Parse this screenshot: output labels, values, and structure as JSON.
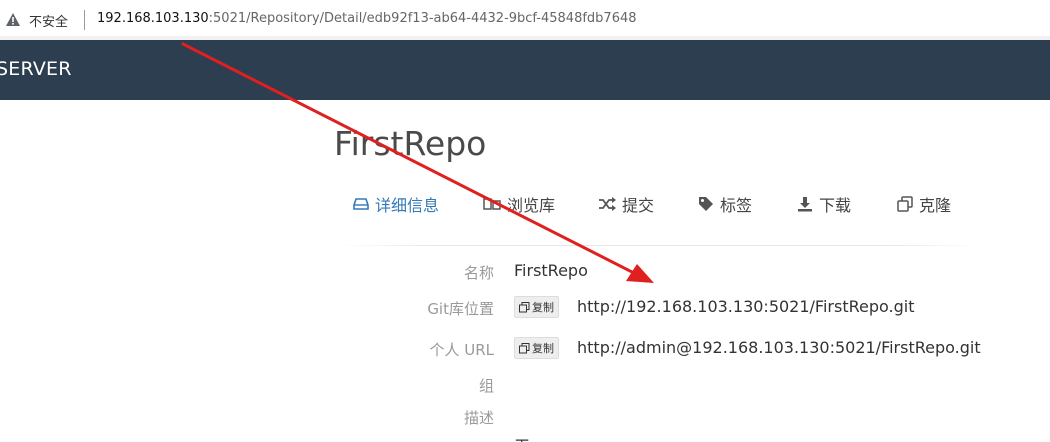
{
  "browser": {
    "security_label": "不安全",
    "url_host": "192.168.103.130",
    "url_rest": ":5021/Repository/Detail/edb92f13-ab64-4432-9bcf-45848fdb7648"
  },
  "navbar": {
    "brand": "SERVER"
  },
  "repo": {
    "title": "FirstRepo"
  },
  "tabs": [
    {
      "label": "详细信息",
      "icon": "drive-icon",
      "active": true
    },
    {
      "label": "浏览库",
      "icon": "browse-icon",
      "active": false
    },
    {
      "label": "提交",
      "icon": "shuffle-icon",
      "active": false
    },
    {
      "label": "标签",
      "icon": "tag-icon",
      "active": false
    },
    {
      "label": "下载",
      "icon": "download-icon",
      "active": false
    },
    {
      "label": "克隆",
      "icon": "clone-icon",
      "active": false
    }
  ],
  "details": {
    "name_label": "名称",
    "name_value": "FirstRepo",
    "git_label": "Git库位置",
    "git_url": "http://192.168.103.130:5021/FirstRepo.git",
    "personal_label": "个人 URL",
    "personal_url": "http://admin@192.168.103.130:5021/FirstRepo.git",
    "group_label": "组",
    "desc_label": "描述",
    "copy_label": "复制",
    "partial_value": "无"
  },
  "colors": {
    "navbar_bg": "#2d3e50",
    "active_tab": "#337ab7",
    "annotation_arrow": "#e02020"
  }
}
